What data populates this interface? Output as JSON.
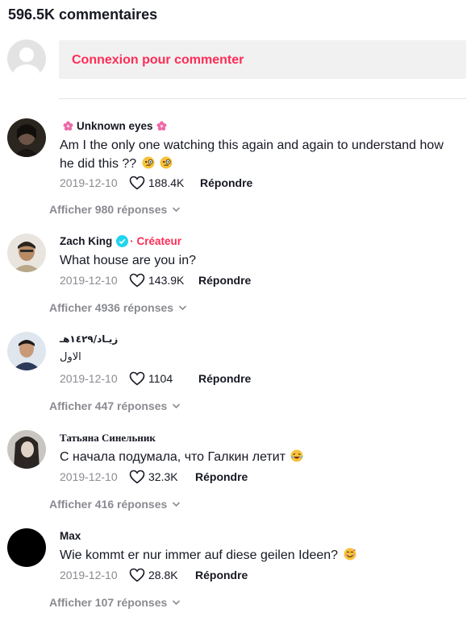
{
  "header": {
    "title": "596.5K commentaires"
  },
  "login": {
    "prompt": "Connexion pour commenter"
  },
  "comments": [
    {
      "user": "Unknown eyes",
      "text": "Am I the only one watching this again and again to understand how he did this ??",
      "date": "2019-12-10",
      "likes": "188.4K",
      "reply": "Répondre",
      "more": "Afficher 980 réponses",
      "avatar": "dark-portrait",
      "emoji": "face-with-monocle-emoji"
    },
    {
      "user": "Zach King",
      "badge": "· Créateur",
      "text": "What house are you in?",
      "date": "2019-12-10",
      "likes": "143.9K",
      "reply": "Répondre",
      "more": "Afficher 4936 réponses",
      "avatar": "man-portrait"
    },
    {
      "user": "زيـاد/١٤٢٩هـ",
      "text": "الاول",
      "date": "2019-12-10",
      "likes": "1104",
      "reply": "Répondre",
      "more": "Afficher 447 réponses",
      "avatar": "young-man-portrait"
    },
    {
      "user": "Татьяна Синельник",
      "text": "С начала подумала, что Галкин летит",
      "date": "2019-12-10",
      "likes": "32.3K",
      "reply": "Répondre",
      "more": "Afficher 416 réponses",
      "avatar": "woman-portrait",
      "emoji": "laughing-face-emoji"
    },
    {
      "user": "Max",
      "text": "Wie kommt er nur immer auf diese geilen Ideen?",
      "date": "2019-12-10",
      "likes": "28.8K",
      "reply": "Répondre",
      "more": "Afficher 107 réponses",
      "avatar": "black-avatar",
      "emoji": "smiling-hearts-emoji"
    }
  ],
  "colors": {
    "accent": "#fe2c55",
    "verified": "#20d5ec",
    "muted": "#8a8b91"
  }
}
